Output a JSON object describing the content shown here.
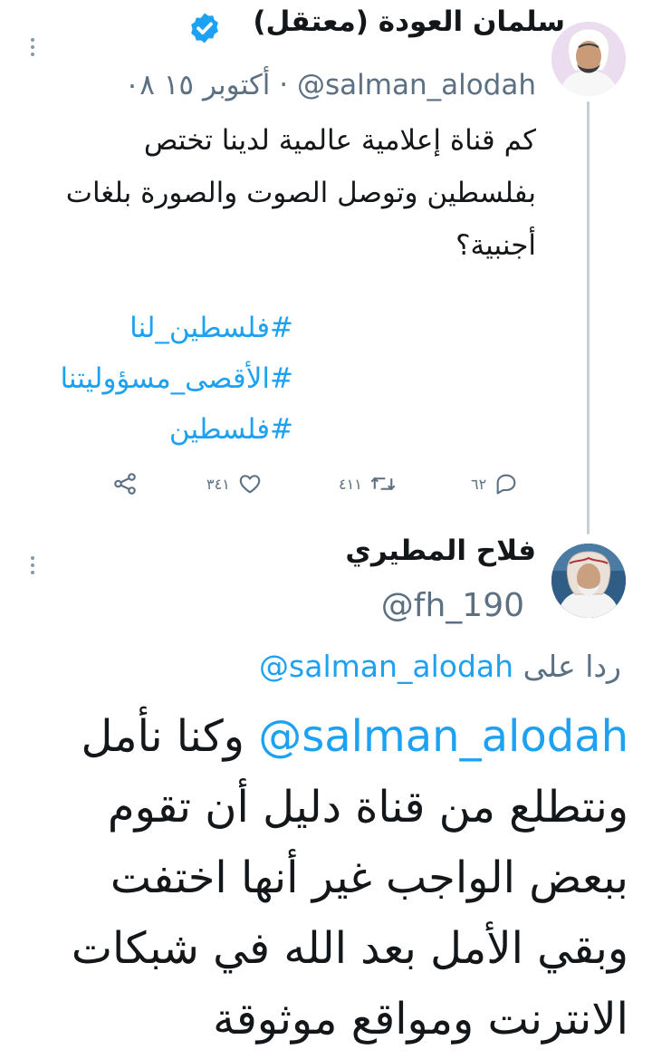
{
  "tweet": {
    "author_name": "سلمان العودة (معتقل)",
    "handle": "@salman_alodah",
    "separator": "·",
    "time": "٠٨",
    "date": "أكتوبر ١٥",
    "text": "كم قناة إعلامية عالمية لدينا تختص بفلسطين وتوصل الصوت والصورة بلغات أجنبية؟",
    "hashtags": [
      "#فلسطين_لنا",
      "#الأقصى_مسؤوليتنا",
      "#فلسطين"
    ],
    "actions": {
      "replies": "٦٢",
      "retweets": "٤١١",
      "likes": "٣٤١"
    },
    "icons": {
      "verified": "verified-badge-icon",
      "reply": "reply-icon",
      "retweet": "retweet-icon",
      "like": "heart-icon",
      "share": "share-icon",
      "more": "more-vertical-icon"
    }
  },
  "reply": {
    "author_name": "فلاح المطيري",
    "handle": "@fh_190",
    "replying_to_prefix": "ردا على",
    "replying_to_handle": "@salman_alodah",
    "mention": "@salman_alodah",
    "text": "وكنا نأمل ونتطلع من قناة دليل أن تقوم ببعض الواجب غير أنها اختفت وبقي الأمل بعد الله في شبكات الانترنت ومواقع موثوقة"
  },
  "colors": {
    "link": "#1da1f2",
    "secondary": "#5b7083",
    "thread_line": "#c4cfd6"
  }
}
